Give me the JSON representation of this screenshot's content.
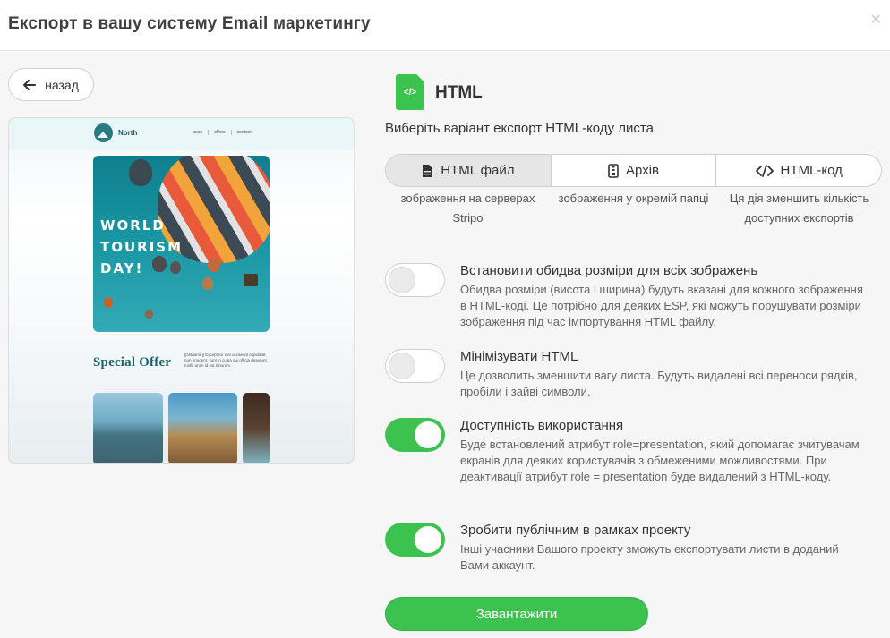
{
  "header": {
    "title": "Експорт в вашу систему Email маркетингу",
    "close_glyph": "×"
  },
  "back": {
    "label": "назад"
  },
  "preview": {
    "brand": "North",
    "nav": [
      "tours",
      "offers",
      "contact"
    ],
    "hero_text": [
      "WORLD",
      "TOURISM",
      "DAY!"
    ],
    "special": "Special Offer",
    "copy": "[[fistname]] Excepteur sint occaecat cupidatat non proident, sunt in culpa qui officia deserunt mollit anim id est laborum."
  },
  "format": {
    "icon_text": "</>",
    "title": "HTML",
    "choose_label": "Виберіть варіант експорт HTML-коду листа"
  },
  "segments": [
    {
      "label": "HTML файл",
      "icon": "file-icon",
      "note": "зображення на серверах Stripo",
      "active": true
    },
    {
      "label": "Архів",
      "icon": "archive-icon",
      "note": "зображення у окремій папці",
      "active": false
    },
    {
      "label": "HTML-код",
      "icon": "code-icon",
      "note": "Ця дія зменшить кількість доступних експортів",
      "active": false
    }
  ],
  "options": [
    {
      "title": "Встановити обидва розміри для всіх зображень",
      "desc": "Обидва розміри (висота і ширина) будуть вказані для кожного зображення в HTML-коді. Це потрібно для деяких ESP, які можуть порушувати розміри зображення під час імпортування HTML файлу.",
      "enabled": false
    },
    {
      "title": "Мінімізувати HTML",
      "desc": "Це дозволить зменшити вагу листа. Будуть видалені всі переноси рядків, пробіли і зайві символи.",
      "enabled": false
    },
    {
      "title": "Доступність використання",
      "desc": "Буде встановлений атрибут role=presentation, який допомагає зчитувачам екранів для деяких користувачів з обмеженими можливостями. При деактивації атрибут role = presentation буде видалений з HTML-коду.",
      "enabled": true
    },
    {
      "title": "Зробити публічним в рамках проекту",
      "desc": "Інші учасники Вашого проекту зможуть експортувати листи в доданий Вами аккаунт.",
      "enabled": true
    }
  ],
  "download": {
    "label": "Завантажити"
  },
  "colors": {
    "accent": "#3cc24f",
    "active_segment": "#e6e6e6"
  }
}
